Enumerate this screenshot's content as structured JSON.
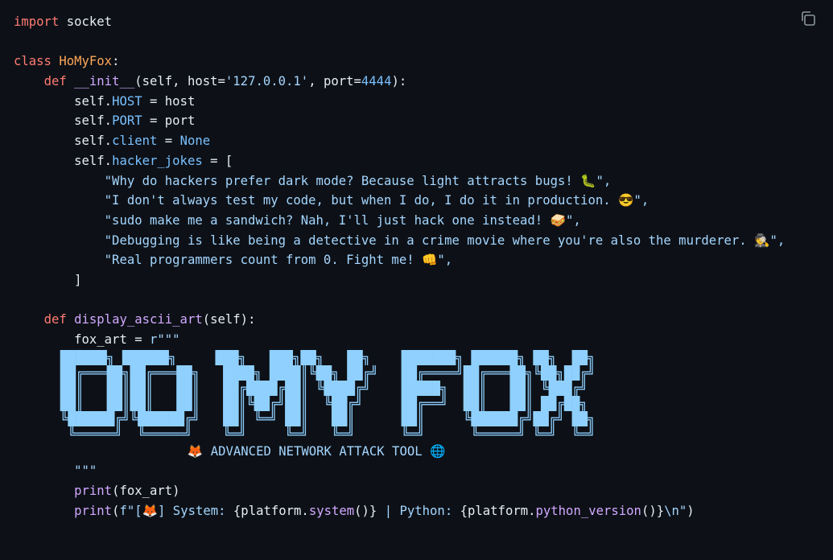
{
  "toolbar": {
    "copy_icon": "copy-icon"
  },
  "code": {
    "l1": {
      "a": "import",
      "b": " socket"
    },
    "l3": {
      "a": "class",
      "b": "HoMyFox",
      "c": ":"
    },
    "l4": {
      "a": "def",
      "b": "__init__",
      "c": "(self, host=",
      "d": "'127.0.0.1'",
      "e": ", port=",
      "f": "4444",
      "g": "):"
    },
    "l5": {
      "a": "self.",
      "b": "HOST",
      "c": " = host"
    },
    "l6": {
      "a": "self.",
      "b": "PORT",
      "c": " = port"
    },
    "l7": {
      "a": "self.",
      "b": "client",
      "c": " = ",
      "d": "None"
    },
    "l8": {
      "a": "self.",
      "b": "hacker_jokes",
      "c": " = ["
    },
    "l9": "\"Why do hackers prefer dark mode? Because light attracts bugs! 🐛\",",
    "l10": "\"I don't always test my code, but when I do, I do it in production. 😎\",",
    "l11": "\"sudo make me a sandwich? Nah, I'll just hack one instead! 🥪\",",
    "l12": "\"Debugging is like being a detective in a crime movie where you're also the murderer. 🕵️\",",
    "l13": "\"Real programmers count from 0. Fight me! 👊\",",
    "l14": "]",
    "l16": {
      "a": "def",
      "b": "display_ascii_art",
      "c": "(self):"
    },
    "l17": {
      "a": "fox_art = ",
      "b": "r\"\"\""
    },
    "ascii": [
      "██████╗ ██████╗     ███╗   ███╗██╗   ██╗    ███████╗ ██████╗ ██╗  ██╗",
      "██╔═══██╗██╔═══██╗   ████╗ ████║╚██╗ ██╔╝   ██╔════╝██╔═══██╗╚██╗██╔╝",
      "██║   ██║██║   ██║   ██╔████╔██║ ╚████╔╝    █████╗  ██║   ██║ ╚███╔╝ ",
      "██║   ██║██║   ██║   ██║╚██╔╝██║  ╚██╔╝     ██╔══╝  ██║   ██║ ██╔██╗ ",
      "╚██████╔╝╚██████╔╝   ██║ ╚═╝ ██║   ██║      ██║     ╚██████╔╝██╔╝ ██╗",
      " ╚═════╝  ╚═════╝    ╚═╝     ╚═╝   ╚═╝      ╚═╝      ╚═════╝ ╚═╝  ╚═╝"
    ],
    "l24": "               🦊 ADVANCED NETWORK ATTACK TOOL 🌐",
    "l25": "\"\"\"",
    "l26": {
      "a": "print",
      "b": "(fox_art)"
    },
    "l27": {
      "a": "print",
      "b": "(",
      "c": "f\"[🦊] System: ",
      "d": "{platform.",
      "e": "system",
      "f": "()}",
      "g": " | Python: ",
      "h": "{platform.",
      "i": "python_version",
      "j": "()}",
      "k": "\\n\"",
      "l": ")"
    }
  }
}
